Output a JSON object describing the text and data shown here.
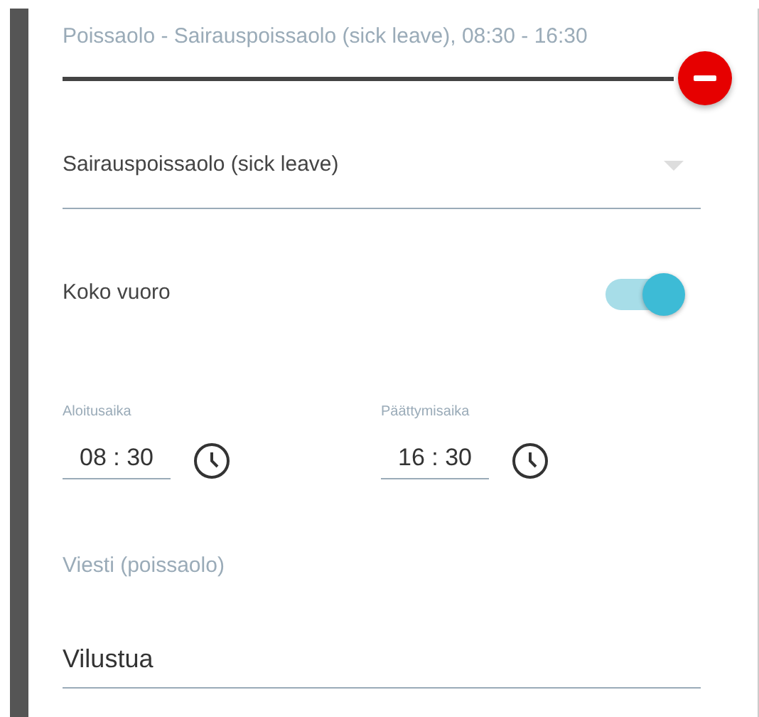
{
  "absence": {
    "title": "Poissaolo - Sairauspoissaolo (sick leave), 08:30 - 16:30"
  },
  "reason_select": {
    "value": "Sairauspoissaolo (sick leave)"
  },
  "full_shift": {
    "label": "Koko vuoro",
    "on": true
  },
  "times": [
    {
      "label": "Aloitusaika",
      "value": "08 : 30"
    },
    {
      "label": "Päättymisaika",
      "value": "16 : 30"
    }
  ],
  "message": {
    "label": "Viesti (poissaolo)",
    "value": "Vilustua"
  }
}
